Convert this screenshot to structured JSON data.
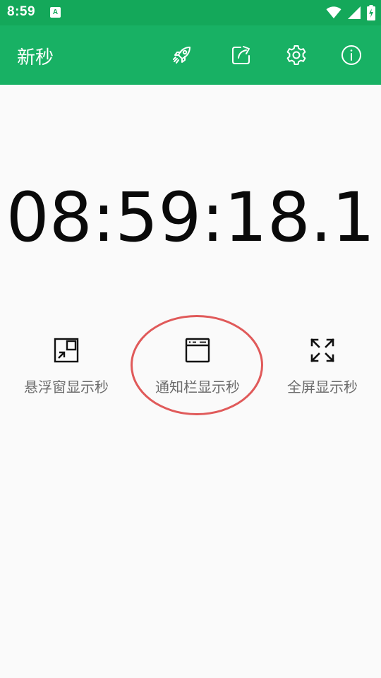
{
  "status_bar": {
    "time": "8:59",
    "app_icon_letter": "A",
    "icons": [
      "wifi-icon",
      "signal-icon",
      "battery-charging-icon"
    ]
  },
  "app_bar": {
    "title": "新秒",
    "actions": [
      "rocket-icon",
      "share-icon",
      "gear-icon",
      "info-icon"
    ]
  },
  "clock": {
    "value": "08:59:18.1"
  },
  "options": [
    {
      "label": "悬浮窗显示秒",
      "icon": "floating-window-icon"
    },
    {
      "label": "通知栏显示秒",
      "icon": "notification-bar-icon"
    },
    {
      "label": "全屏显示秒",
      "icon": "fullscreen-icon"
    }
  ],
  "colors": {
    "status_bar": "#14a85a",
    "app_bar": "#18b164",
    "background": "#fafafa",
    "annotation": "#e05a5a",
    "label": "#6b6b6b"
  }
}
